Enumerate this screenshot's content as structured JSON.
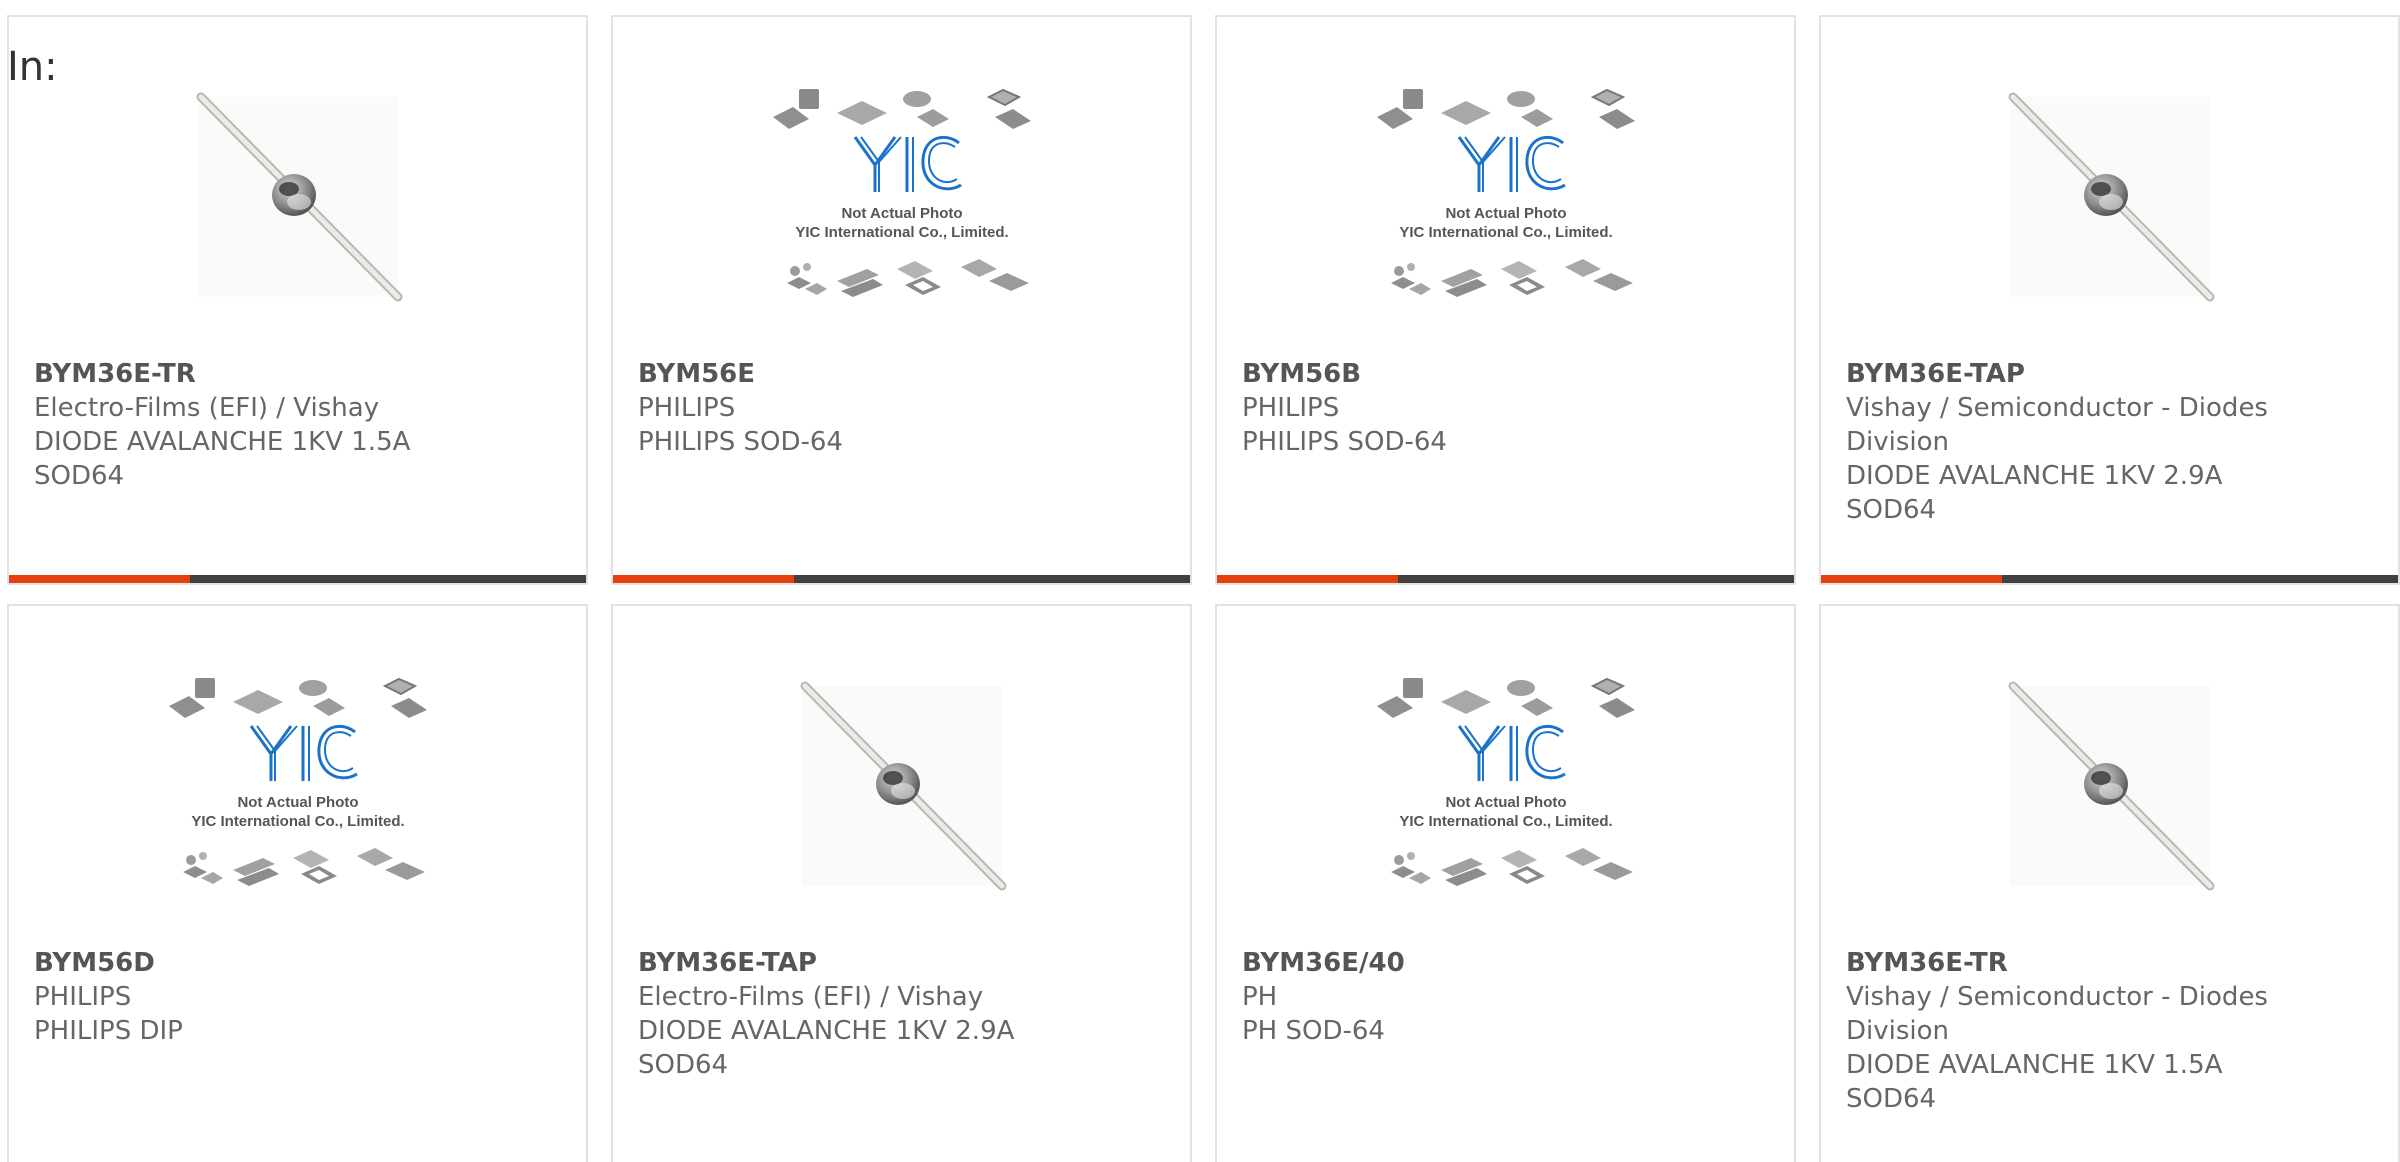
{
  "heading": "In:",
  "colors": {
    "accent": "#e8400c",
    "bar": "#404040",
    "yic_blue": "#1a73c9",
    "text": "#666666"
  },
  "placeholder_caption": {
    "line1": "Not Actual Photo",
    "line2": "YIC International Co., Limited."
  },
  "products": [
    {
      "part": "BYM36E-TR",
      "image": "diode-photo",
      "lines": [
        "Electro-Films (EFI) / Vishay",
        "DIODE AVALANCHE 1KV 1.5A",
        "SOD64"
      ]
    },
    {
      "part": "BYM56E",
      "image": "yic-placeholder",
      "lines": [
        "PHILIPS",
        "PHILIPS SOD-64"
      ]
    },
    {
      "part": "BYM56B",
      "image": "yic-placeholder",
      "lines": [
        "PHILIPS",
        "PHILIPS SOD-64"
      ]
    },
    {
      "part": "BYM36E-TAP",
      "image": "diode-photo",
      "lines": [
        "Vishay / Semiconductor - Diodes",
        "Division",
        "DIODE AVALANCHE 1KV 2.9A",
        "SOD64"
      ]
    },
    {
      "part": "BYM56D",
      "image": "yic-placeholder",
      "lines": [
        "PHILIPS",
        "PHILIPS DIP"
      ]
    },
    {
      "part": "BYM36E-TAP",
      "image": "diode-photo",
      "lines": [
        "Electro-Films (EFI) / Vishay",
        "DIODE AVALANCHE 1KV 2.9A",
        "SOD64"
      ]
    },
    {
      "part": "BYM36E/40",
      "image": "yic-placeholder",
      "lines": [
        "PH",
        "PH SOD-64"
      ]
    },
    {
      "part": "BYM36E-TR",
      "image": "diode-photo",
      "lines": [
        "Vishay / Semiconductor - Diodes",
        "Division",
        "DIODE AVALANCHE 1KV 1.5A",
        "SOD64"
      ]
    }
  ]
}
